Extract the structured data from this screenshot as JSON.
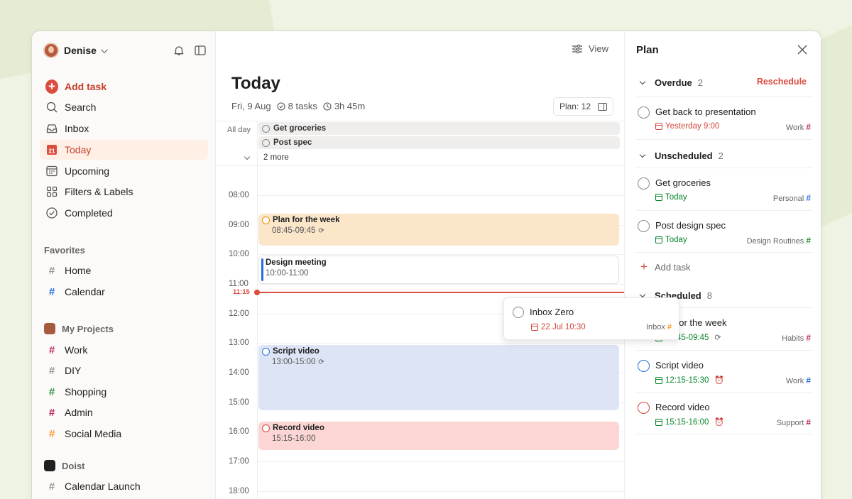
{
  "colors": {
    "accent": "#dc4c3e",
    "active_bg": "#ffefe5",
    "green": "#058527",
    "blue": "#246fe0"
  },
  "sidebar": {
    "user_name": "Denise",
    "add_task_label": "Add task",
    "nav": [
      {
        "label": "Search",
        "icon": "search-icon"
      },
      {
        "label": "Inbox",
        "icon": "inbox-icon"
      },
      {
        "label": "Today",
        "icon": "calendar-today-icon",
        "date_badge": "21",
        "active": true
      },
      {
        "label": "Upcoming",
        "icon": "calendar-grid-icon"
      },
      {
        "label": "Filters & Labels",
        "icon": "grid-icon"
      },
      {
        "label": "Completed",
        "icon": "check-circle-icon"
      }
    ],
    "favorites_title": "Favorites",
    "favorites": [
      {
        "label": "Home",
        "color": "#999999"
      },
      {
        "label": "Calendar",
        "color": "#246fe0"
      }
    ],
    "projects_title": "My Projects",
    "projects": [
      {
        "label": "Work",
        "color": "#b8255f"
      },
      {
        "label": "DIY",
        "color": "#999999"
      },
      {
        "label": "Shopping",
        "color": "#299438"
      },
      {
        "label": "Admin",
        "color": "#b8255f"
      },
      {
        "label": "Social Media",
        "color": "#ff9933"
      }
    ],
    "team_title": "Doist",
    "team_projects": [
      {
        "label": "Calendar Launch",
        "color": "#999999"
      }
    ]
  },
  "center": {
    "view_label": "View",
    "title": "Today",
    "date": "Fri, 9 Aug",
    "tasks_count": "8 tasks",
    "duration": "3h 45m",
    "plan_chip": "Plan: 12",
    "all_day_label": "All day",
    "all_day_events": [
      "Get groceries",
      "Post spec"
    ],
    "more_label": "2 more",
    "hours": [
      "08:00",
      "09:00",
      "10:00",
      "11:00",
      "12:00",
      "13:00",
      "14:00",
      "15:00",
      "16:00",
      "17:00",
      "18:00"
    ],
    "now_label": "11:15",
    "events": [
      {
        "title": "Plan for the week",
        "time": "08:45-09:45",
        "recurring": true,
        "bg": "#fbe6ca",
        "circle": "#eb8909"
      },
      {
        "title": "Design meeting",
        "time": "10:00-11:00",
        "recurring": false,
        "bg": "#ffffff",
        "bar": "#246fe0"
      },
      {
        "title": "Script video",
        "time": "13:00-15:00",
        "recurring": true,
        "bg": "#dde4f5",
        "circle": "#246fe0"
      },
      {
        "title": "Record video",
        "time": "15:15-16:00",
        "recurring": false,
        "bg": "#fcd6d4",
        "circle": "#d1453b"
      }
    ],
    "drag_card": {
      "name": "Inbox Zero",
      "date": "22 Jul 10:30",
      "project": "Inbox",
      "project_color": "#ff9933"
    }
  },
  "plan_panel": {
    "title": "Plan",
    "overdue": {
      "title": "Overdue",
      "count": "2",
      "action": "Reschedule",
      "tasks": [
        {
          "name": "Get back to presentation",
          "date": "Yesterday 9:00",
          "date_color": "#d1453b",
          "project": "Work",
          "project_color": "#b8255f"
        }
      ]
    },
    "unscheduled": {
      "title": "Unscheduled",
      "count": "2",
      "tasks": [
        {
          "name": "Get groceries",
          "date": "Today",
          "date_color": "#058527",
          "project": "Personal",
          "project_color": "#246fe0"
        },
        {
          "name": "Post design spec",
          "date": "Today",
          "date_color": "#058527",
          "project": "Design Routines",
          "project_color": "#299438"
        }
      ],
      "add_label": "Add task"
    },
    "scheduled": {
      "title": "Scheduled",
      "count": "8",
      "tasks": [
        {
          "name": "Plan for the week",
          "date": "08:45-09:45",
          "date_color": "#058527",
          "project": "Habits",
          "project_color": "#b8255f",
          "circle": "#888888"
        },
        {
          "name": "Script video",
          "date": "12:15-15:30",
          "date_color": "#058527",
          "project": "Work",
          "project_color": "#246fe0",
          "circle": "#246fe0"
        },
        {
          "name": "Record video",
          "date": "15:15-16:00",
          "date_color": "#058527",
          "project": "Support",
          "project_color": "#b8255f",
          "circle": "#d1453b"
        }
      ]
    }
  }
}
